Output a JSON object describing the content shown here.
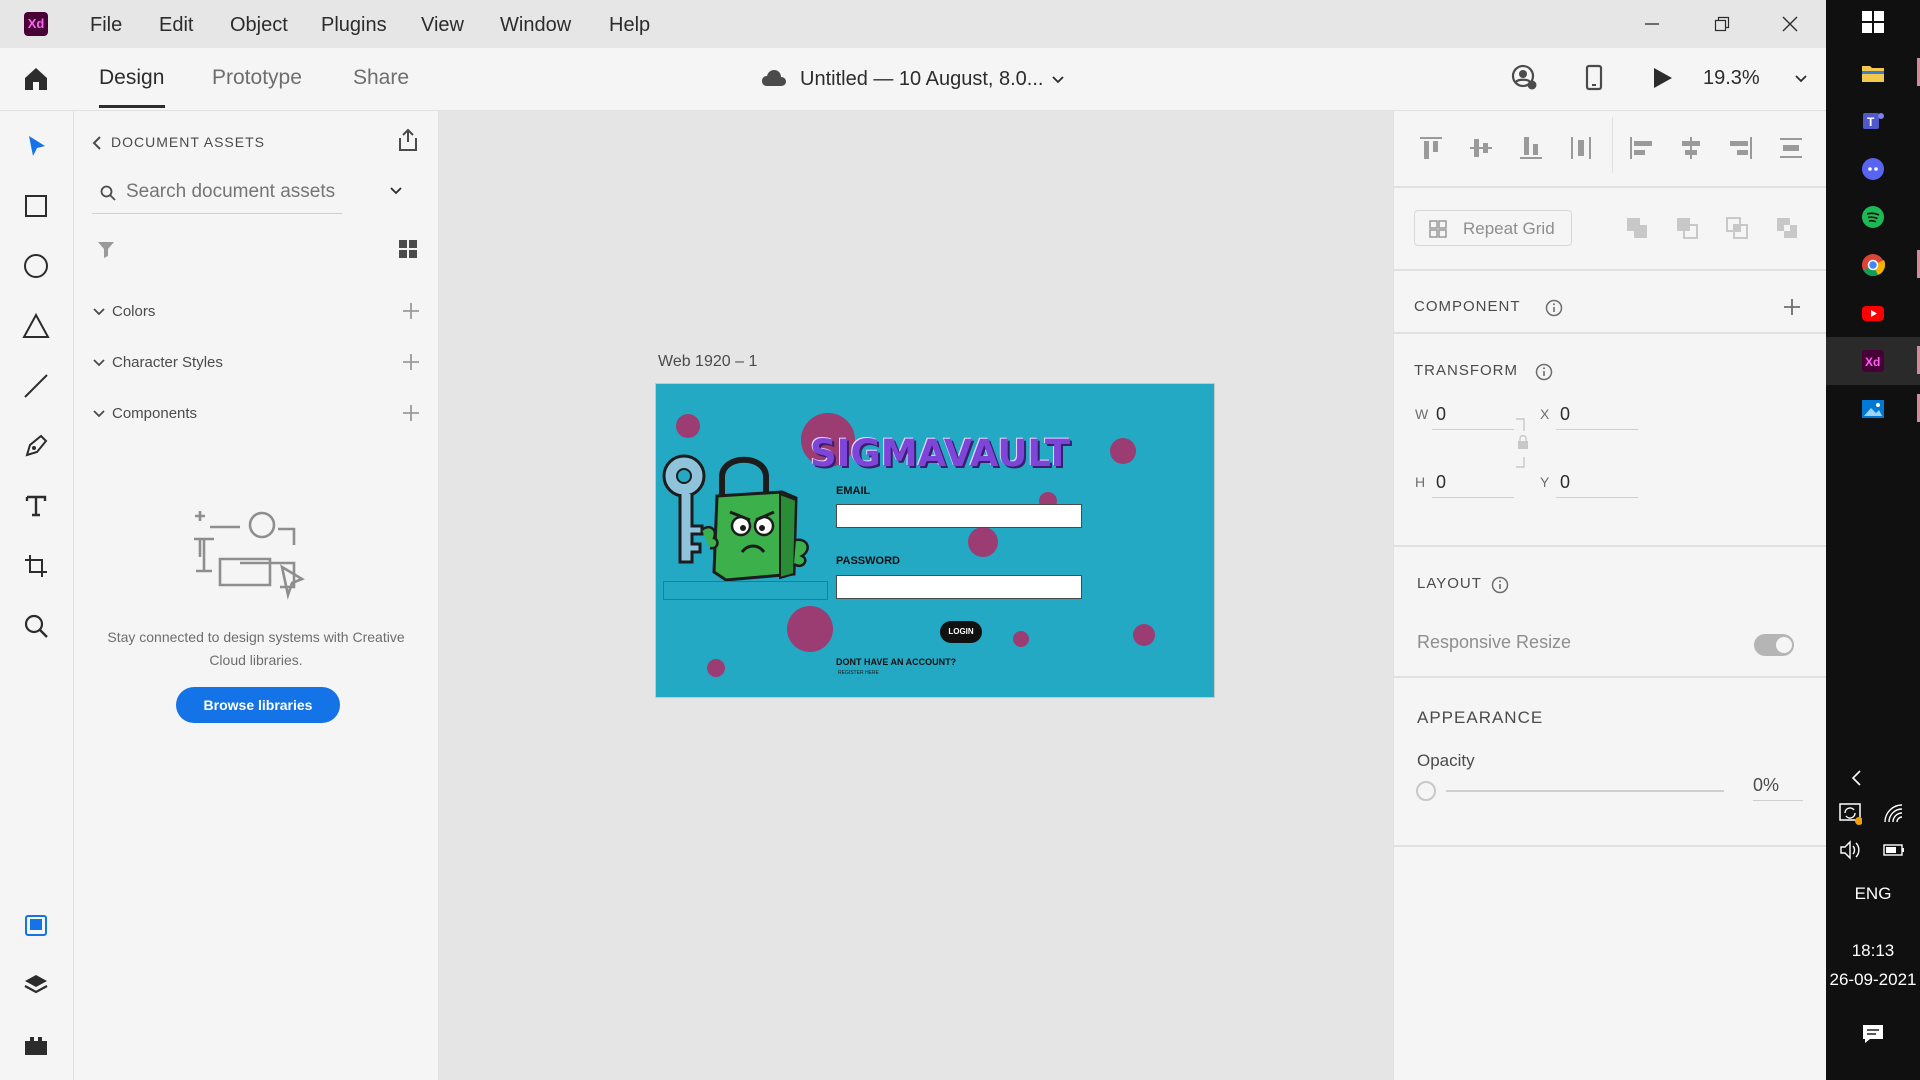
{
  "app": {
    "logo_text": "Xd"
  },
  "menu": [
    "File",
    "Edit",
    "Object",
    "Plugins",
    "View",
    "Window",
    "Help"
  ],
  "header": {
    "tabs": [
      "Design",
      "Prototype",
      "Share"
    ],
    "active_tab": "Design",
    "document_title": "Untitled — 10 August, 8.0...",
    "zoom": "19.3%"
  },
  "assets": {
    "title": "DOCUMENT ASSETS",
    "search_placeholder": "Search document assets",
    "sections": [
      "Colors",
      "Character Styles",
      "Components"
    ],
    "empty_message": "Stay connected to design systems with Creative Cloud libraries.",
    "browse_label": "Browse libraries"
  },
  "canvas": {
    "artboard_label": "Web 1920 – 1",
    "artboard": {
      "brand": "SIGMAVAULT",
      "email_label": "EMAIL",
      "password_label": "PASSWORD",
      "login_label": "LOGIN",
      "signup_prompt": "DONT HAVE AN ACCOUNT?",
      "signup_link": "REGISTER HERE"
    }
  },
  "properties": {
    "repeat_grid": "Repeat Grid",
    "component_heading": "COMPONENT",
    "transform_heading": "TRANSFORM",
    "w_label": "W",
    "w_value": "0",
    "h_label": "H",
    "h_value": "0",
    "x_label": "X",
    "x_value": "0",
    "y_label": "Y",
    "y_value": "0",
    "layout_heading": "LAYOUT",
    "responsive_resize": "Responsive Resize",
    "appearance_heading": "APPEARANCE",
    "opacity_label": "Opacity",
    "opacity_value": "0%"
  },
  "taskbar": {
    "language": "ENG",
    "time": "18:13",
    "date": "26-09-2021"
  },
  "colors": {
    "accent_blue": "#1473e6",
    "artboard_bg": "#23a9c4",
    "bubble": "#9b3c72",
    "brand_purple": "#7d46d8",
    "lock_green": "#3cb04a"
  }
}
